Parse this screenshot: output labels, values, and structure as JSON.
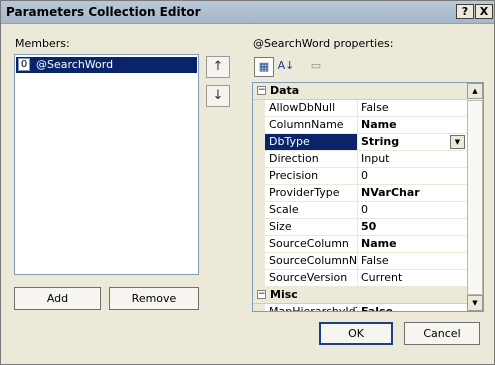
{
  "window": {
    "title": "Parameters Collection Editor",
    "help_glyph": "?",
    "close_glyph": "X"
  },
  "members": {
    "label": "Members:",
    "items": [
      {
        "index": "0",
        "name": "@SearchWord"
      }
    ],
    "add_label": "Add",
    "remove_label": "Remove"
  },
  "arrows": {
    "up": "↑",
    "down": "↓",
    "up_icon": "arrow-up-icon",
    "down_icon": "arrow-down-icon"
  },
  "properties": {
    "label": "@SearchWord properties:",
    "toolbar": {
      "categorized": "categorized-icon",
      "alphabetical": "alphabetical-icon",
      "pages": "property-pages-icon",
      "alpha_glyph": "A↓",
      "cat_glyph": "▦",
      "pages_glyph": "▭"
    },
    "categories": [
      {
        "name": "Data",
        "glyph": "⊟"
      },
      {
        "name": "Misc",
        "glyph": "⊟"
      }
    ],
    "rows": [
      {
        "name": "AllowDbNull",
        "value": "False"
      },
      {
        "name": "ColumnName",
        "value": "Name"
      },
      {
        "name": "DbType",
        "value": "String"
      },
      {
        "name": "Direction",
        "value": "Input"
      },
      {
        "name": "Precision",
        "value": "0"
      },
      {
        "name": "ProviderType",
        "value": "NVarChar"
      },
      {
        "name": "Scale",
        "value": "0"
      },
      {
        "name": "Size",
        "value": "50"
      },
      {
        "name": "SourceColumn",
        "value": "Name"
      },
      {
        "name": "SourceColumnNullMapping",
        "value": "False"
      },
      {
        "name": "SourceVersion",
        "value": "Current"
      },
      {
        "name": "MapHierarchyIdToSpatial",
        "value": "False"
      }
    ],
    "dropdown_glyph": "▼"
  },
  "scroll": {
    "up": "▲",
    "down": "▼"
  },
  "buttons": {
    "ok": "OK",
    "cancel": "Cancel"
  },
  "colors": {
    "selection": "#0a246a",
    "dialog": "#ece9d8",
    "title_bar": "#b9c9d9"
  }
}
